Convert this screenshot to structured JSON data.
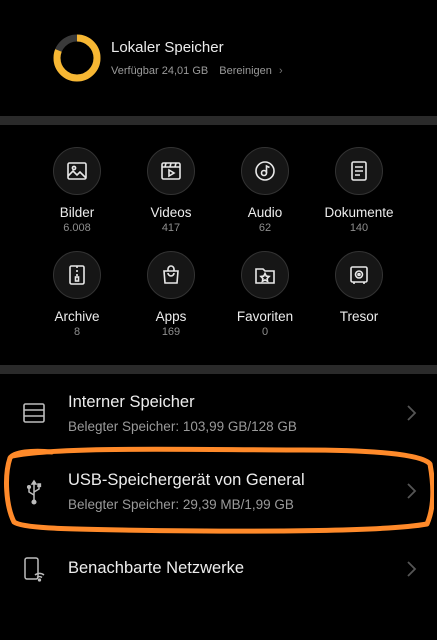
{
  "storage": {
    "title": "Lokaler Speicher",
    "available": "Verfügbar 24,01 GB",
    "clean_link": "Bereinigen",
    "ring_color": "#f7b733",
    "used_fraction": 0.81
  },
  "categories": [
    {
      "label": "Bilder",
      "count": "6.008",
      "icon": "image-icon"
    },
    {
      "label": "Videos",
      "count": "417",
      "icon": "video-icon"
    },
    {
      "label": "Audio",
      "count": "62",
      "icon": "audio-icon"
    },
    {
      "label": "Dokumente",
      "count": "140",
      "icon": "document-icon"
    },
    {
      "label": "Archive",
      "count": "8",
      "icon": "archive-icon"
    },
    {
      "label": "Apps",
      "count": "169",
      "icon": "apps-icon"
    },
    {
      "label": "Favoriten",
      "count": "0",
      "icon": "favorites-icon"
    },
    {
      "label": "Tresor",
      "count": "",
      "icon": "safe-icon"
    }
  ],
  "locations": [
    {
      "title": "Interner Speicher",
      "subtitle": "Belegter Speicher: 103,99 GB/128 GB",
      "icon": "internal-storage-icon"
    },
    {
      "title": "USB-Speichergerät von General",
      "subtitle": "Belegter Speicher: 29,39 MB/1,99 GB",
      "icon": "usb-icon"
    },
    {
      "title": "Benachbarte Netzwerke",
      "subtitle": "",
      "icon": "network-icon"
    }
  ],
  "highlight_color": "#ff8a2a"
}
